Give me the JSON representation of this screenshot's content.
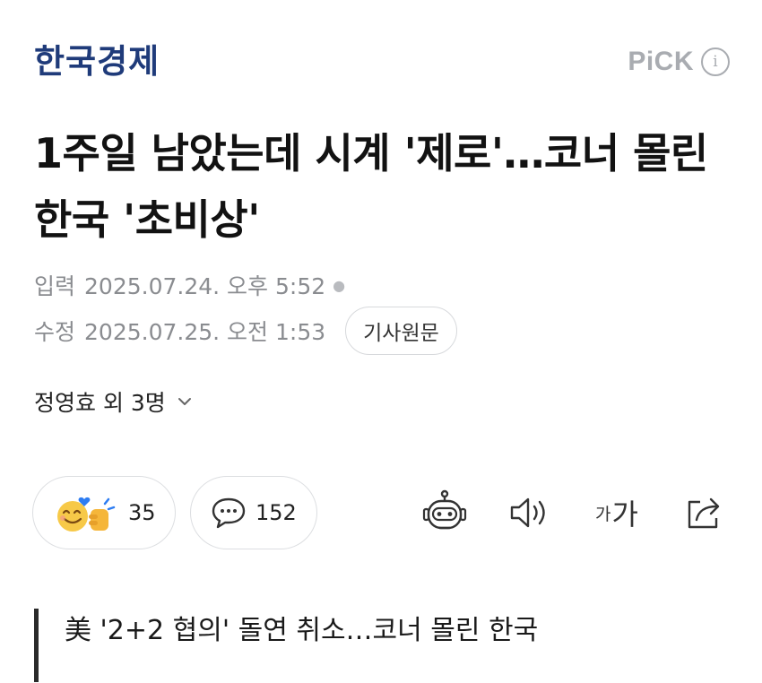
{
  "header": {
    "press_name": "한국경제",
    "pick_label": "PiCK",
    "info_glyph": "i"
  },
  "article": {
    "headline": "1주일 남았는데 시계 '제로'…코너 몰린 한국 '초비상'",
    "published_label": "입력",
    "published_at": "2025.07.24. 오후 5:52",
    "modified_label": "수정",
    "modified_at": "2025.07.25. 오전 1:53",
    "original_link_label": "기사원문",
    "author": "정영효 외 3명",
    "subtitle": "美 '2+2 협의' 돌연 취소…코너 몰린 한국"
  },
  "actions": {
    "reaction_count": "35",
    "comment_count": "152",
    "font_small": "가",
    "font_large": "가"
  },
  "icons": {
    "reaction": "emoji-reaction-icon",
    "comment": "speech-bubble-icon",
    "robot": "ai-summary-robot-icon",
    "speaker": "speaker-icon",
    "font": "font-size-icon",
    "share": "share-icon",
    "chevron": "chevron-down-icon"
  },
  "colors": {
    "press_logo": "#1f3b7a",
    "muted": "#8a8c90",
    "border": "#dcdee1",
    "reaction_yellow": "#f7c948",
    "heart_blue": "#2e7df2"
  }
}
